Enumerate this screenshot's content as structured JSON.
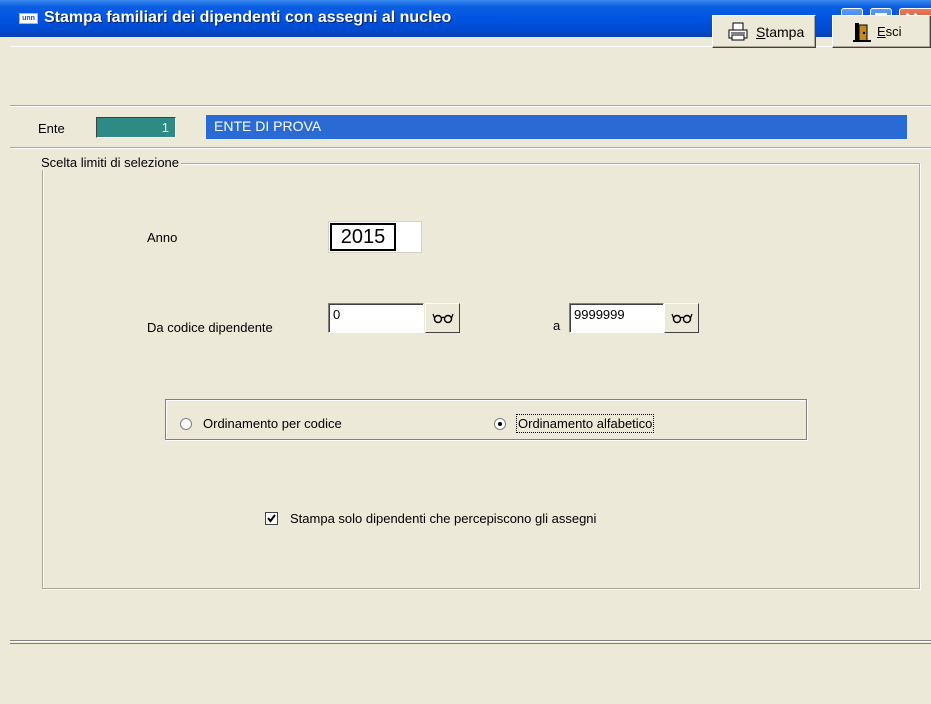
{
  "window": {
    "title": "Stampa familiari dei dipendenti con assegni al nucleo",
    "icon_text": "unn"
  },
  "toolbar": {
    "stampa_label": "Stampa",
    "esci_label": "Esci"
  },
  "ente": {
    "label": "Ente",
    "code": "1",
    "name": "ENTE DI PROVA"
  },
  "selection": {
    "group_title": "Scelta limiti di selezione",
    "anno_label": "Anno",
    "anno_value": "2015",
    "da_label": "Da codice dipendente",
    "da_value": "0",
    "a_label": "a",
    "a_value": "9999999"
  },
  "ordering": {
    "option_codice": "Ordinamento per codice",
    "option_alfabetico": "Ordinamento alfabetico",
    "selected": "alfabetico"
  },
  "filter": {
    "checkbox_label": "Stampa solo dipendenti che percepiscono gli assegni",
    "checked": true
  },
  "colors": {
    "title_bar": "#0054e3",
    "ente_code_bg": "#2d8a84",
    "ente_name_bg": "#2a6ad4",
    "window_bg": "#ece9d8"
  }
}
